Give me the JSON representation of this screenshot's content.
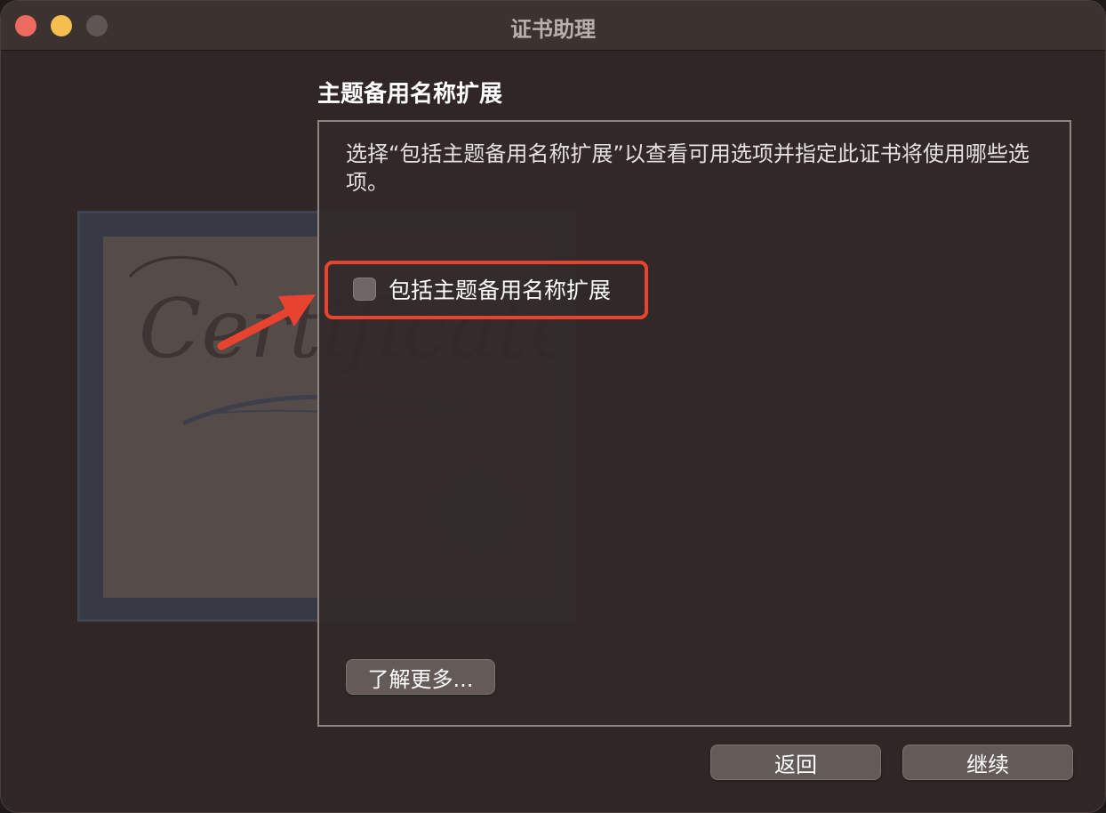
{
  "window": {
    "title": "证书助理"
  },
  "page": {
    "heading": "主题备用名称扩展",
    "description": "选择“包括主题备用名称扩展”以查看可用选项并指定此证书将使用哪些选项。",
    "checkbox": {
      "label": "包括主题备用名称扩展",
      "checked": false
    },
    "learn_more_label": "了解更多..."
  },
  "footer": {
    "back_label": "返回",
    "continue_label": "继续"
  },
  "artwork": {
    "certificate_text": "Certificate"
  },
  "colors": {
    "annotation": "#e8432e",
    "window_bg": "#2f2625"
  }
}
